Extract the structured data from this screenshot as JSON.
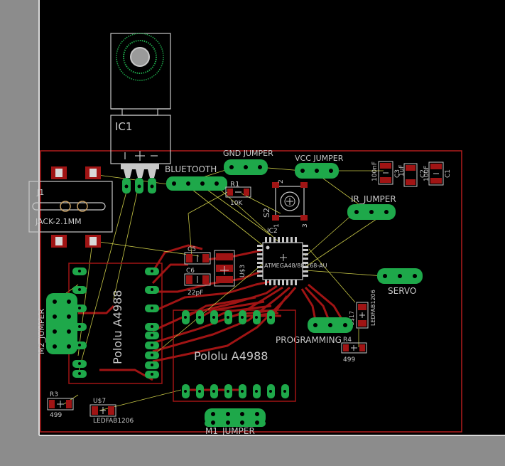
{
  "app": {
    "view": "PCB layout editor - board view"
  },
  "colors": {
    "background": "#000000",
    "margin": "#8c8c8c",
    "board_outline": "#b21e1e",
    "copper_top": "#a01414",
    "pad": "#1ea84a",
    "ratsnest": "#c8c846",
    "silkscreen": "#c8c8c8",
    "hole": "#9a9a9a"
  },
  "labels": {
    "ic1": "IC1",
    "bluetooth": "BLUETOOTH",
    "gnd_jumper": "GND  JUMPER",
    "vcc_jumper": "VCC  JUMPER",
    "r1": "R1",
    "r1_value": "10K",
    "s2": "S2",
    "c100nf": "100nF",
    "c1uf": "1uF",
    "c10uf": "10uF",
    "c1": "C1",
    "c2": "C2",
    "c3": "C3",
    "ir_jumper": "IR_JUMPER",
    "j1": "J1",
    "jack": "JACK-2.1MM",
    "ic2": "IC2",
    "mcu": "ATMEGA48/88/168-AU",
    "c5": "C5",
    "c6": "C6",
    "c_22pf": "22pF",
    "u3": "U$3",
    "servo": "SERVO",
    "led_right": "LEDFAB1206",
    "u17": "U$17",
    "pololu_left": "Pololu A4988",
    "pololu_right": "Pololu A4988",
    "m2_jumper": "M2_JUMPER",
    "programming": "PROGRAMMING",
    "r4": "R4",
    "r4_value": "499",
    "r3": "R3",
    "r3_value": "499",
    "u37": "U$7",
    "led_bottom": "LEDFAB1206",
    "m1_jumper": "M1_JUMPER",
    "sw_pin": "1",
    "sw_pin2": "2",
    "sw_pin3": "3"
  }
}
